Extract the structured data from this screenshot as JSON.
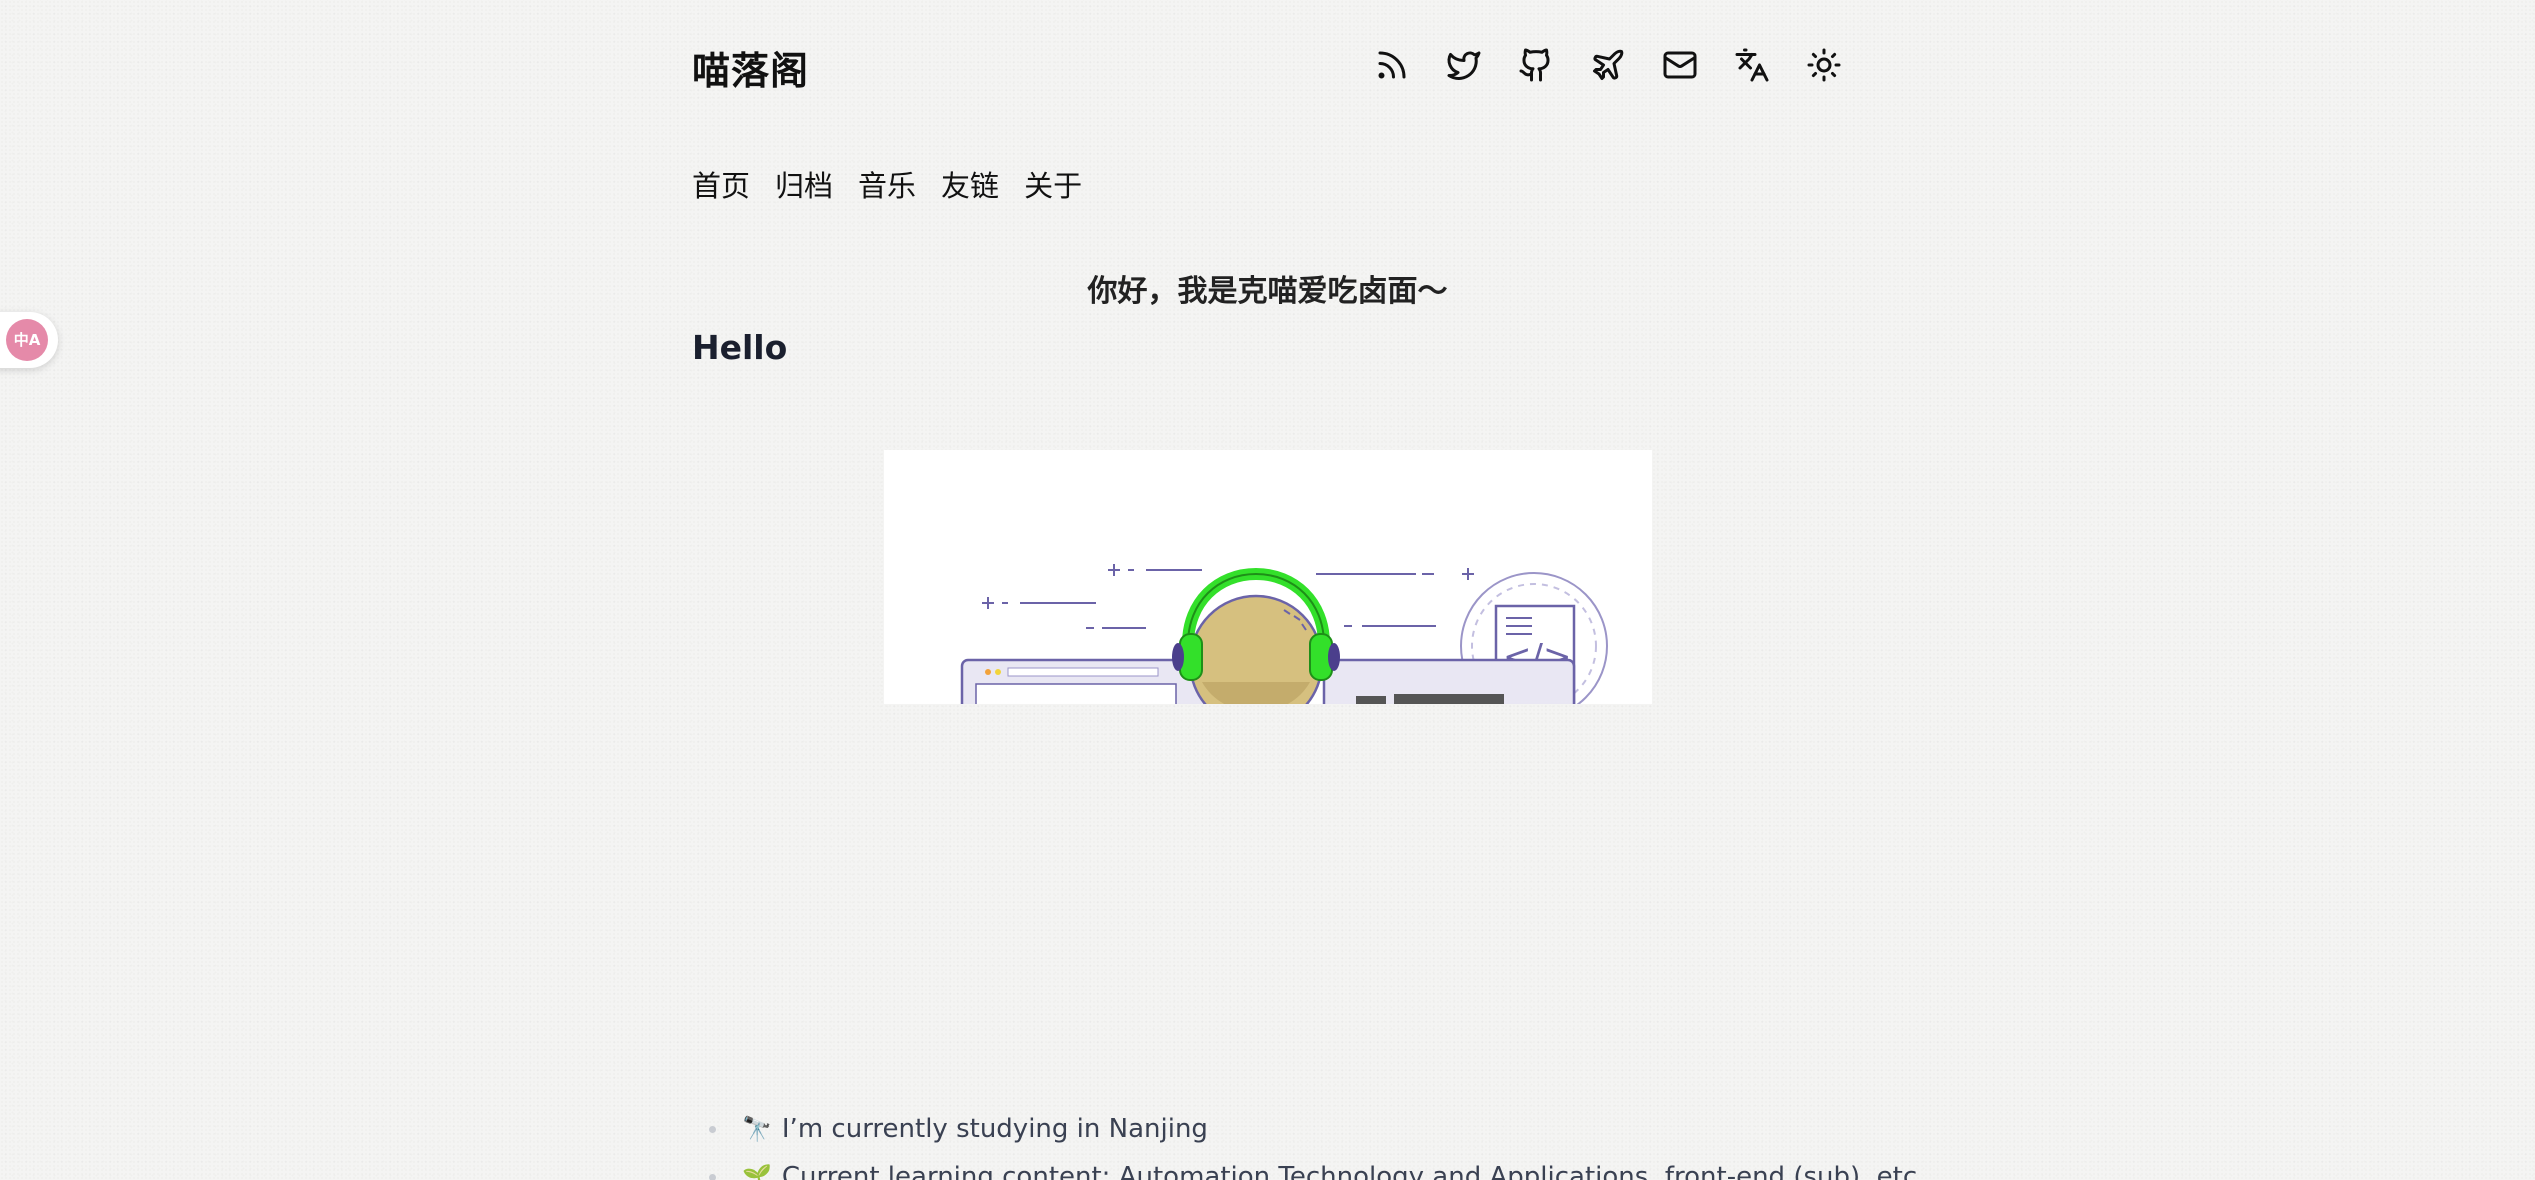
{
  "site": {
    "title": "喵落阁"
  },
  "header": {
    "icons": [
      "rss-icon",
      "twitter-icon",
      "github-icon",
      "plane-icon",
      "mail-icon",
      "translate-icon",
      "sun-icon"
    ]
  },
  "nav": {
    "items": [
      "首页",
      "归档",
      "音乐",
      "友链",
      "关于"
    ]
  },
  "main": {
    "headline": "你好，我是克喵爱吃卤面～",
    "hello": "Hello",
    "list": [
      {
        "emoji": "🔭",
        "text": "I’m currently studying in Nanjing"
      },
      {
        "emoji": "🌱",
        "text": "Current learning content: Automation Technology and Applications, front-end (sub), etc."
      }
    ]
  },
  "translate_fab": {
    "label": "中A"
  },
  "colors": {
    "background": "#f4f4f3",
    "text": "#111111",
    "fab": "#e58aa9",
    "headphones": "#33e02a",
    "illustration_line": "#6b63a8"
  }
}
